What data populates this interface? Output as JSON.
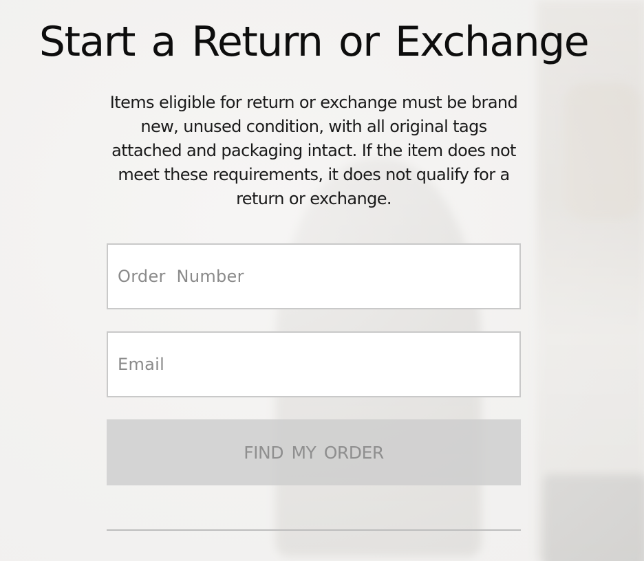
{
  "page": {
    "title": "Start a  Return or  Exchange",
    "intro": "Items eligible for return or exchange must be brand new, unused condition, with all original tags attached and packaging intact.  If the item does not meet these requirements, it does not qualify for a return or exchange."
  },
  "form": {
    "order_number": {
      "placeholder": "Order  Number",
      "value": ""
    },
    "email": {
      "placeholder": "Email",
      "value": ""
    },
    "submit_label": "FIND  MY ORDER",
    "submit_disabled": true
  },
  "colors": {
    "background": "#f1f0ef",
    "title_text": "#0d0d0d",
    "field_border": "#c9c9c9",
    "placeholder_text": "#8a8a8a",
    "button_bg": "#cdcdcd",
    "button_text": "#8f8f8f",
    "divider": "#bdbdbd"
  }
}
